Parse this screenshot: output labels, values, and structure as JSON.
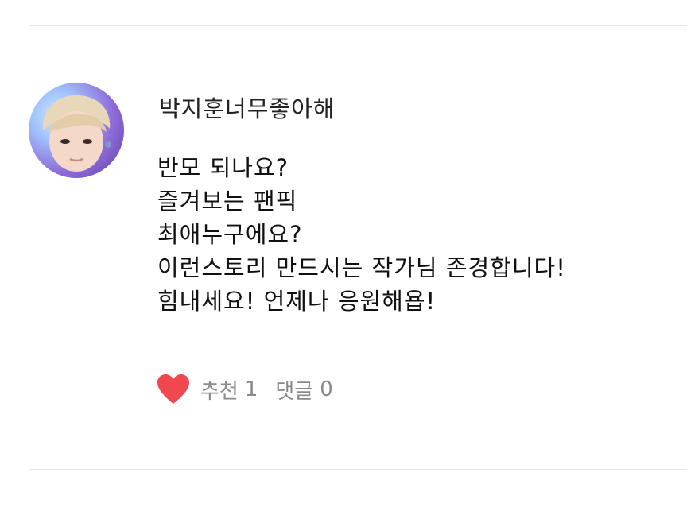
{
  "comment": {
    "username": "박지훈너무좋아해",
    "lines": [
      "반모 되나요?",
      "즐겨보는 팬픽",
      "최애누구에요?",
      "이런스토리 만드시는 작가님 존경합니다!",
      "힘내세요! 언제나 응원해욥!"
    ],
    "recommend_label": "추천",
    "recommend_count": "1",
    "reply_label": "댓글",
    "reply_count": "0",
    "heart_color": "#f0484e"
  },
  "icons": {
    "avatar": "profile-photo",
    "heart": "heart-icon"
  }
}
